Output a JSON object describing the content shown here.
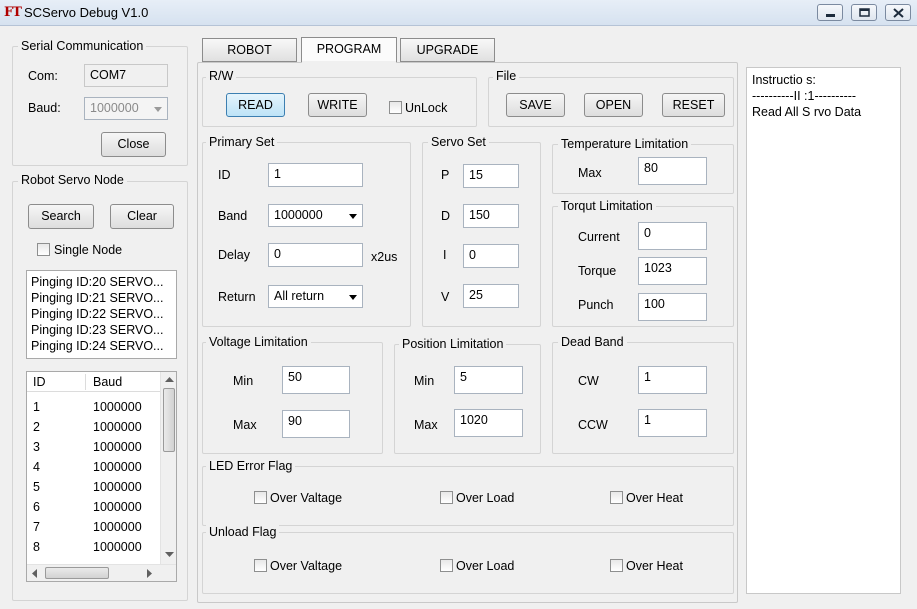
{
  "window": {
    "title": "SCServo Debug V1.0",
    "logo": "FT"
  },
  "serial": {
    "legend": "Serial Communication",
    "com_label": "Com:",
    "com_value": "COM7",
    "baud_label": "Baud:",
    "baud_value": "1000000",
    "close_label": "Close"
  },
  "servo_node": {
    "legend": "Robot Servo Node",
    "search_label": "Search",
    "clear_label": "Clear",
    "single_node_label": "Single Node",
    "log": [
      "Pinging ID:20 SERVO...",
      "Pinging ID:21 SERVO...",
      "Pinging ID:22 SERVO...",
      "Pinging ID:23 SERVO...",
      "Pinging ID:24 SERVO..."
    ],
    "table": {
      "headers": [
        "ID",
        "Baud"
      ],
      "rows": [
        [
          "1",
          "1000000"
        ],
        [
          "2",
          "1000000"
        ],
        [
          "3",
          "1000000"
        ],
        [
          "4",
          "1000000"
        ],
        [
          "5",
          "1000000"
        ],
        [
          "6",
          "1000000"
        ],
        [
          "7",
          "1000000"
        ],
        [
          "8",
          "1000000"
        ]
      ]
    }
  },
  "tabs": [
    "ROBOT",
    "PROGRAM",
    "UPGRADE"
  ],
  "rw": {
    "legend": "R/W",
    "read": "READ",
    "write": "WRITE",
    "unlock": "UnLock"
  },
  "file": {
    "legend": "File",
    "save": "SAVE",
    "open": "OPEN",
    "reset": "RESET"
  },
  "primary": {
    "legend": "Primary Set",
    "id_label": "ID",
    "id_value": "1",
    "band_label": "Band",
    "band_value": "1000000",
    "delay_label": "Delay",
    "delay_value": "0",
    "delay_unit": "x2us",
    "return_label": "Return",
    "return_value": "All return"
  },
  "servo_set": {
    "legend": "Servo Set",
    "p_label": "P",
    "p_value": "15",
    "d_label": "D",
    "d_value": "150",
    "i_label": "I",
    "i_value": "0",
    "v_label": "V",
    "v_value": "25"
  },
  "temperature": {
    "legend": "Temperature Limitation",
    "max_label": "Max",
    "max_value": "80"
  },
  "torque": {
    "legend": "Torqut Limitation",
    "current_label": "Current",
    "current_value": "0",
    "torque_label": "Torque",
    "torque_value": "1023",
    "punch_label": "Punch",
    "punch_value": "100"
  },
  "voltage": {
    "legend": "Voltage Limitation",
    "min_label": "Min",
    "min_value": "50",
    "max_label": "Max",
    "max_value": "90"
  },
  "position": {
    "legend": "Position Limitation",
    "min_label": "Min",
    "min_value": "5",
    "max_label": "Max",
    "max_value": "1020"
  },
  "deadband": {
    "legend": "Dead Band",
    "cw_label": "CW",
    "cw_value": "1",
    "ccw_label": "CCW",
    "ccw_value": "1"
  },
  "led_flag": {
    "legend": "LED Error Flag",
    "voltage": "Over Valtage",
    "load": "Over Load",
    "heat": "Over Heat"
  },
  "unload_flag": {
    "legend": "Unload Flag",
    "voltage": "Over Valtage",
    "load": "Over Load",
    "heat": "Over Heat"
  },
  "instructions": {
    "line1": "Instructio s:",
    "line2": "----------II :1----------",
    "line3": "Read All S rvo Data"
  }
}
